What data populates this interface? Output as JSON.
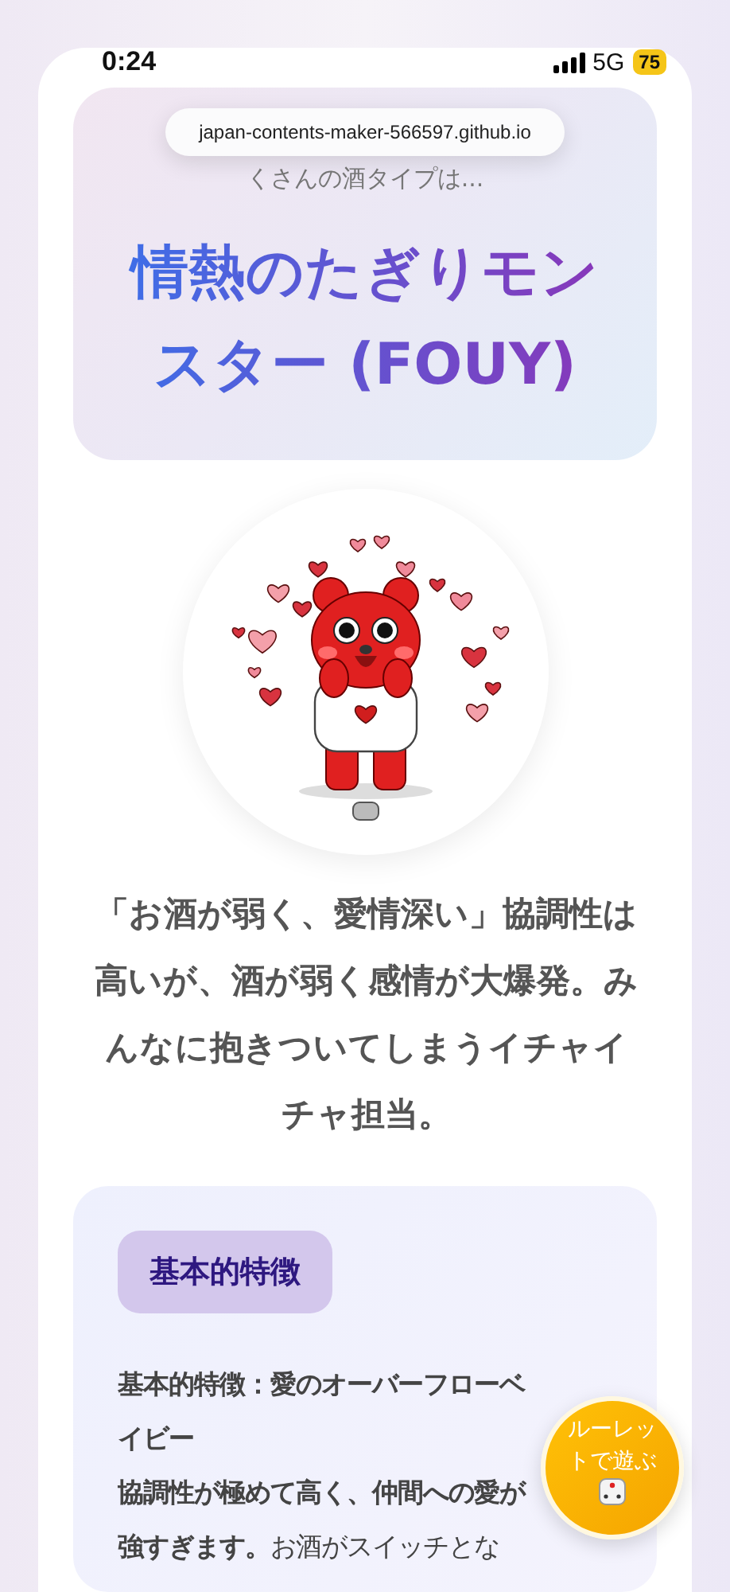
{
  "status_bar": {
    "time": "0:24",
    "network": "5G",
    "battery": "75"
  },
  "address_bar": {
    "url": "japan-contents-maker-566597.github.io"
  },
  "result": {
    "subtitle": "くさんの酒タイプは...",
    "title": "情熱のたぎりモンスター (FOUY)"
  },
  "description": "「お酒が弱く、愛情深い」協調性は高いが、酒が弱く感情が大爆発。みんなに抱きついてしまうイチャイチャ担当。",
  "features": {
    "heading": "基本的特徴",
    "paragraphs": [
      "**基本的特徴：愛のオーバーフローベイビー**",
      "**協調性が極めて高く、仲間への愛が強すぎます。**お酒がスイッチとな"
    ]
  },
  "floating_button": {
    "label": "ルーレットで遊ぶ"
  }
}
